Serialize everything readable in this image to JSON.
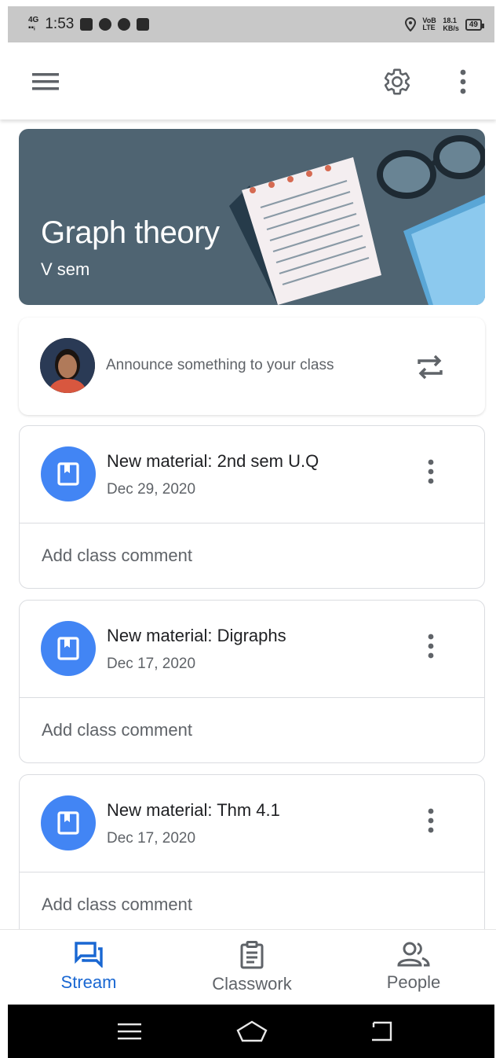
{
  "status_bar": {
    "network": "4G",
    "time": "1:53",
    "right_icons": [
      "location-icon",
      "volte-icon",
      "data-speed-icon",
      "battery-icon"
    ],
    "volte": "VoB LTE",
    "speed_value": "18.1",
    "speed_unit": "KB/s",
    "battery": "49"
  },
  "app_bar": {
    "menu_icon": "hamburger-menu-icon",
    "settings_icon": "gear-icon",
    "more_icon": "more-vert-icon"
  },
  "banner": {
    "title": "Graph theory",
    "subtitle": "V sem",
    "background": "#4f6472"
  },
  "announce": {
    "placeholder": "Announce something to your class",
    "repost_icon": "repost-icon"
  },
  "posts": [
    {
      "title": "New material: 2nd sem U.Q",
      "date": "Dec 29, 2020",
      "comment": "Add class comment"
    },
    {
      "title": "New material: Digraphs",
      "date": "Dec 17, 2020",
      "comment": "Add class comment"
    },
    {
      "title": "New material: Thm 4.1",
      "date": "Dec 17, 2020",
      "comment": "Add class comment"
    }
  ],
  "bottom_nav": {
    "tabs": [
      {
        "label": "Stream",
        "icon": "stream-icon",
        "active": true
      },
      {
        "label": "Classwork",
        "icon": "classwork-icon",
        "active": false
      },
      {
        "label": "People",
        "icon": "people-icon",
        "active": false
      }
    ],
    "active_color": "#1967d2"
  },
  "system_nav": {
    "buttons": [
      "menu-icon",
      "home-icon",
      "back-icon"
    ]
  },
  "colors": {
    "accent": "#4285f4",
    "text_primary": "#202124",
    "text_secondary": "#5f6368"
  }
}
